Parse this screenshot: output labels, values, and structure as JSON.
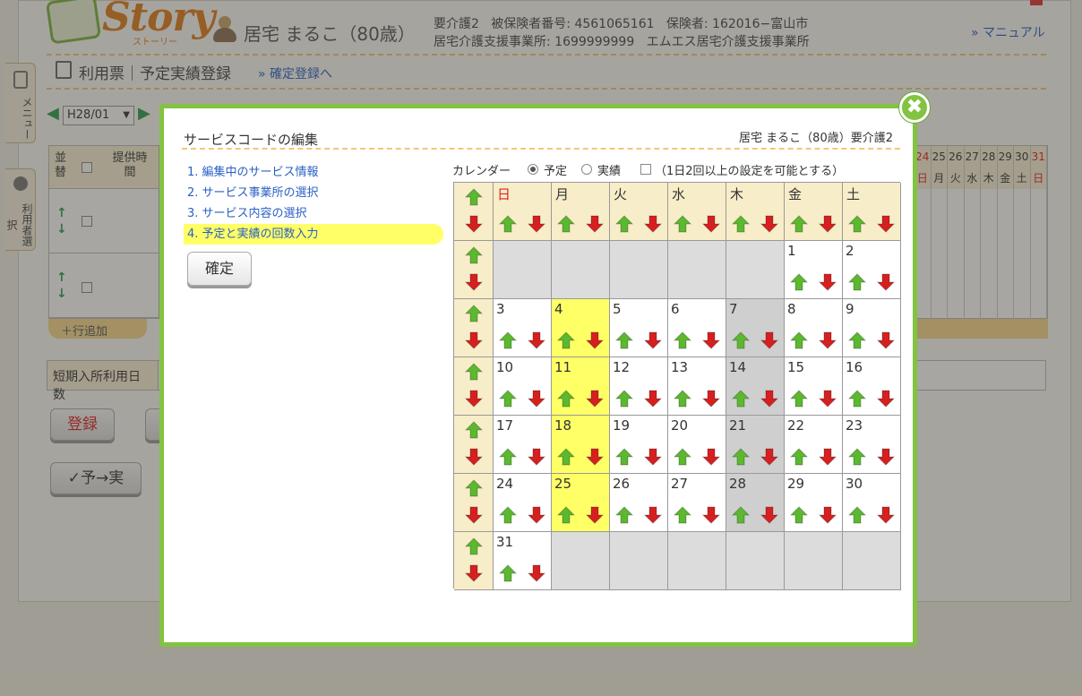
{
  "header": {
    "logo_word": "Story",
    "logo_sub": "ストーリー",
    "user_name": "居宅 まるこ（80歳）",
    "care_level": "要介護2",
    "insured_number": "被保険者番号: 4561065161",
    "insurer": "保険者: 162016−富山市",
    "office_number": "居宅介護支援事業所: 1699999999",
    "office_name": "エムエス居宅介護支援事業所",
    "manual_link": "» マニュアル"
  },
  "page": {
    "title": "利用票｜予定実績登録",
    "confirm_link": "» 確定登録へ",
    "month": "H28/01",
    "side_menu": "メニュー",
    "side_users": "利用者選択",
    "table_col_sort": "並替",
    "table_col_time": "提供時間",
    "add_row": "＋行追加",
    "short_stay_label": "短期入所利用日数",
    "register_button": "登録",
    "plan_to_actual_button": "✓予→実",
    "day_numbers": [
      "24",
      "25",
      "26",
      "27",
      "28",
      "29",
      "30",
      "31"
    ],
    "day_weekdays": [
      "日",
      "月",
      "火",
      "水",
      "木",
      "金",
      "土",
      "日"
    ]
  },
  "dialog": {
    "title": "サービスコードの編集",
    "user_summary": "居宅 まるこ（80歳）要介護2",
    "steps": [
      "1. 編集中のサービス情報",
      "2. サービス事業所の選択",
      "3. サービス内容の選択",
      "4. 予定と実績の回数入力"
    ],
    "active_step": 3,
    "confirm_button": "確定",
    "calendar_label": "カレンダー",
    "radio_plan": "予定",
    "radio_actual": "実績",
    "selected_radio": "予定",
    "multi_checkbox": "（1日2回以上の設定を可能とする）",
    "multi_checked": false,
    "weekdays": [
      "日",
      "月",
      "火",
      "水",
      "木",
      "金",
      "土"
    ],
    "weeks": [
      [
        null,
        null,
        null,
        null,
        null,
        "1",
        "2"
      ],
      [
        "3",
        "4",
        "5",
        "6",
        "7",
        "8",
        "9"
      ],
      [
        "10",
        "11",
        "12",
        "13",
        "14",
        "15",
        "16"
      ],
      [
        "17",
        "18",
        "19",
        "20",
        "21",
        "22",
        "23"
      ],
      [
        "24",
        "25",
        "26",
        "27",
        "28",
        "29",
        "30"
      ],
      [
        "31",
        null,
        null,
        null,
        null,
        null,
        null
      ]
    ],
    "highlight_column": 1,
    "shaded_column": 4,
    "colors": {
      "border_green": "#82c341",
      "highlight_yellow": "#ffff66",
      "header_beige": "#f8edc9",
      "shaded_gray": "#cfcfcf",
      "up_arrow": "#5cb82f",
      "down_arrow": "#d62020",
      "link_blue": "#2a5fc4"
    },
    "icons": {
      "close": "close-icon",
      "up": "up-arrow-icon",
      "down": "down-arrow-icon"
    }
  }
}
